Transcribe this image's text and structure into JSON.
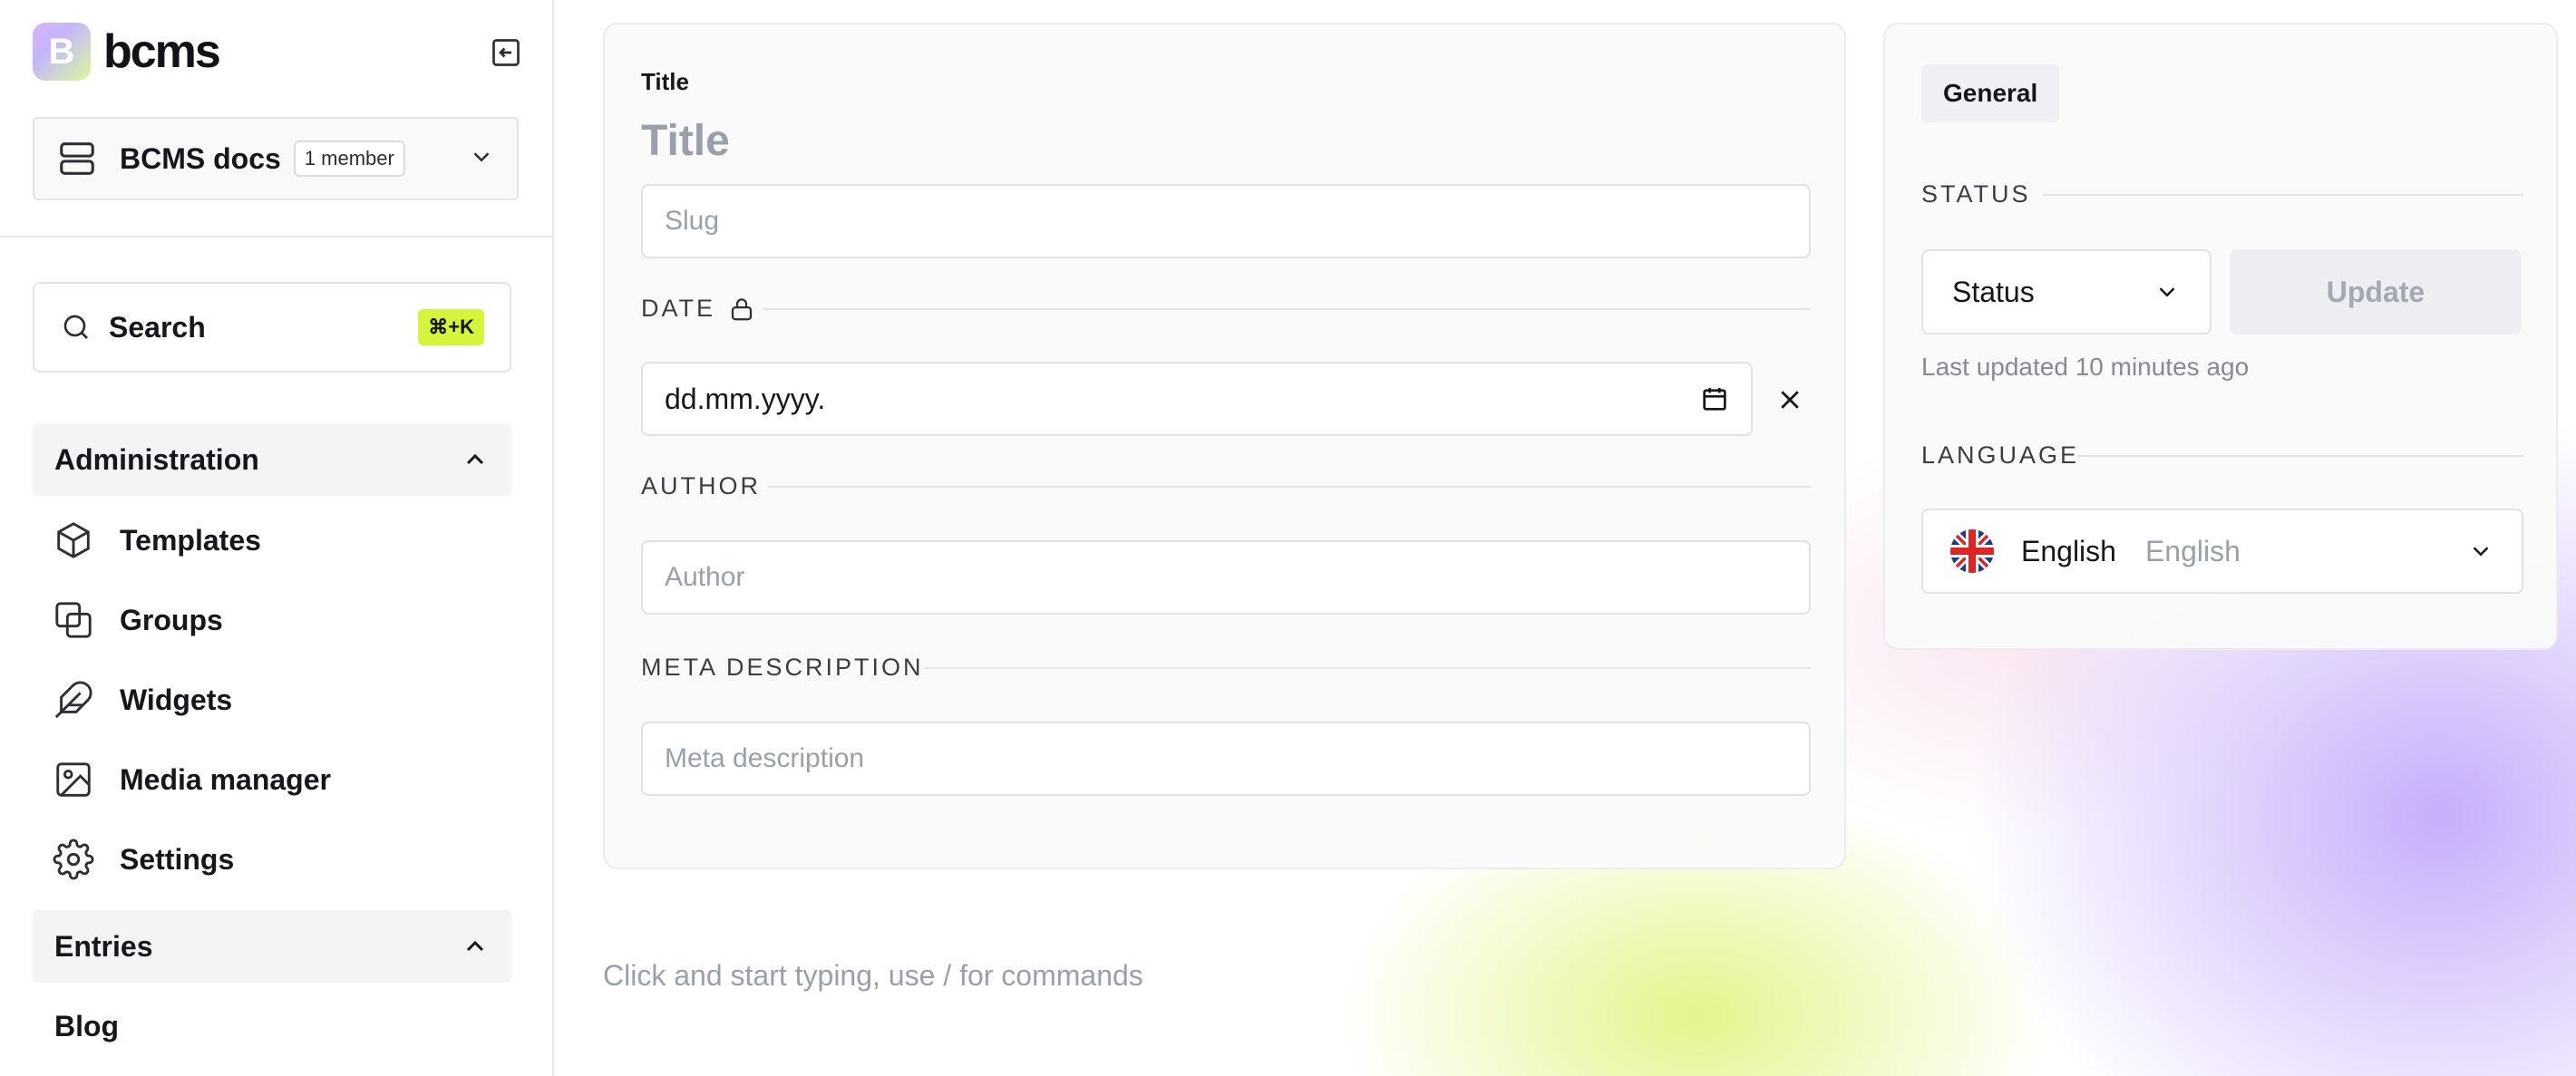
{
  "brand": {
    "logo_letter": "B",
    "name": "bcms"
  },
  "org": {
    "name": "BCMS docs",
    "members_badge": "1 member"
  },
  "search": {
    "label": "Search",
    "shortcut": "⌘+K"
  },
  "sidebar": {
    "administration": {
      "heading": "Administration",
      "items": [
        {
          "label": "Templates",
          "icon": "cube-icon"
        },
        {
          "label": "Groups",
          "icon": "groups-icon"
        },
        {
          "label": "Widgets",
          "icon": "feather-icon"
        },
        {
          "label": "Media manager",
          "icon": "image-icon"
        },
        {
          "label": "Settings",
          "icon": "gear-icon"
        }
      ]
    },
    "entries": {
      "heading": "Entries",
      "items": [
        {
          "label": "Blog"
        }
      ]
    }
  },
  "form": {
    "title_label": "Title",
    "title_placeholder": "Title",
    "slug_placeholder": "Slug",
    "date_label": "DATE",
    "date_value": "dd.mm.yyyy.",
    "author_label": "AUTHOR",
    "author_placeholder": "Author",
    "meta_label": "META DESCRIPTION",
    "meta_placeholder": "Meta description"
  },
  "editor_hint": "Click and start typing, use / for commands",
  "side_panel": {
    "tab": "General",
    "status_label": "STATUS",
    "status_value": "Status",
    "update_button": "Update",
    "last_updated": "Last updated 10 minutes ago",
    "language_label": "LANGUAGE",
    "language_name": "English",
    "language_native": "English"
  },
  "colors": {
    "accent_kbd": "#d4f53c",
    "text_primary": "#15171c",
    "text_muted": "#9aa0ab",
    "border": "#e0e2e6"
  }
}
